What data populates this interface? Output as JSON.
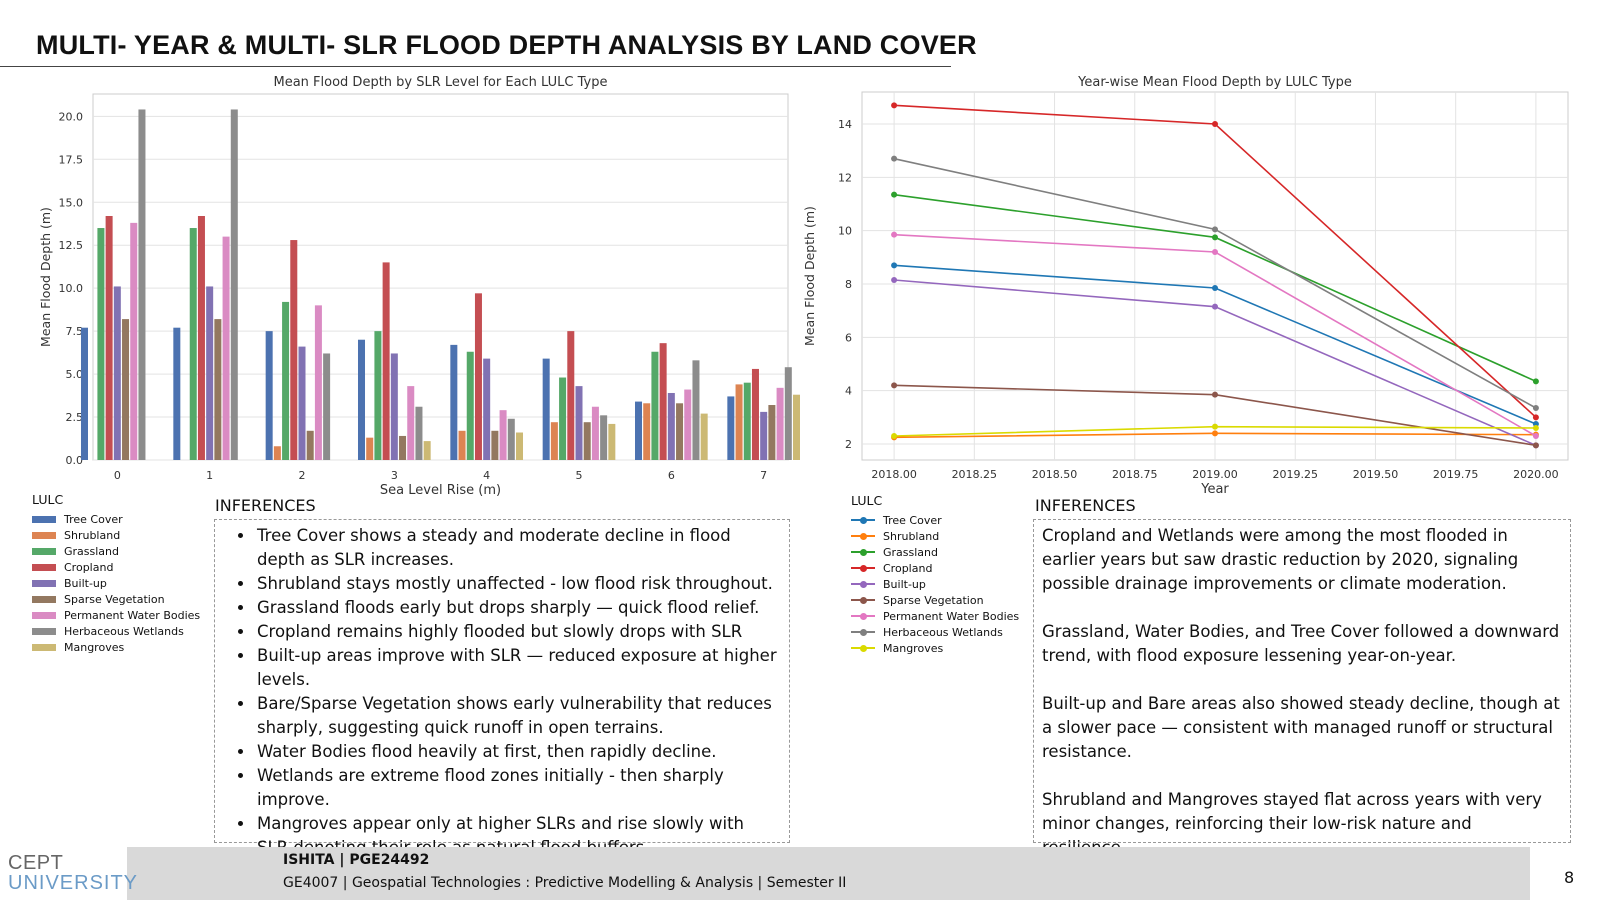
{
  "slide_title": "MULTI- YEAR & MULTI- SLR FLOOD DEPTH ANALYSIS BY LAND COVER",
  "colors": {
    "bar_palette": [
      "#4c72b0",
      "#dd8452",
      "#55a868",
      "#c44e52",
      "#8172b3",
      "#937860",
      "#da8bc3",
      "#8c8c8c",
      "#ccb974"
    ],
    "line_palette": [
      "#1f77b4",
      "#ff7f0e",
      "#2ca02c",
      "#d62728",
      "#9467bd",
      "#8c564b",
      "#e377c2",
      "#7f7f7f",
      "#dada00"
    ]
  },
  "chart_data": [
    {
      "type": "bar",
      "title": "Mean Flood Depth by SLR Level for Each LULC Type",
      "xlabel": "Sea Level Rise (m)",
      "ylabel": "Mean Flood Depth (m)",
      "categories": [
        "0",
        "1",
        "2",
        "3",
        "4",
        "5",
        "6",
        "7"
      ],
      "ylim": [
        0,
        21.3
      ],
      "yticks": [
        "0.0",
        "2.5",
        "5.0",
        "7.5",
        "10.0",
        "12.5",
        "15.0",
        "17.5",
        "20.0"
      ],
      "grid": true,
      "legend_title": "LULC",
      "legend_position": "below-left",
      "series": [
        {
          "name": "Tree Cover",
          "values": [
            7.7,
            7.7,
            7.5,
            7.0,
            6.7,
            5.9,
            3.4,
            3.7
          ]
        },
        {
          "name": "Shrubland",
          "values": [
            0,
            0,
            0.8,
            1.3,
            1.7,
            2.2,
            3.3,
            4.4
          ]
        },
        {
          "name": "Grassland",
          "values": [
            13.5,
            13.5,
            9.2,
            7.5,
            6.3,
            4.8,
            6.3,
            4.5
          ]
        },
        {
          "name": "Cropland",
          "values": [
            14.2,
            14.2,
            12.8,
            11.5,
            9.7,
            7.5,
            6.8,
            5.3
          ]
        },
        {
          "name": "Built-up",
          "values": [
            10.1,
            10.1,
            6.6,
            6.2,
            5.9,
            4.3,
            3.9,
            2.8
          ]
        },
        {
          "name": "Sparse Vegetation",
          "values": [
            8.2,
            8.2,
            1.7,
            1.4,
            1.7,
            2.2,
            3.3,
            3.2
          ]
        },
        {
          "name": "Permanent Water Bodies",
          "values": [
            13.8,
            13.0,
            9.0,
            4.3,
            2.9,
            3.1,
            4.1,
            4.2
          ]
        },
        {
          "name": "Herbaceous Wetlands",
          "values": [
            20.4,
            20.4,
            6.2,
            3.1,
            2.4,
            2.6,
            5.8,
            5.4
          ]
        },
        {
          "name": "Mangroves",
          "values": [
            0,
            0,
            0,
            1.1,
            1.6,
            2.1,
            2.7,
            3.8
          ]
        }
      ]
    },
    {
      "type": "line",
      "title": "Year-wise Mean Flood Depth by LULC Type",
      "xlabel": "Year",
      "ylabel": "Mean Flood Depth (m)",
      "x": [
        2018,
        2019,
        2020
      ],
      "xlim": [
        2017.9,
        2020.1
      ],
      "ylim": [
        1.4,
        15.2
      ],
      "xticks": [
        "2018.00",
        "2018.25",
        "2018.50",
        "2018.75",
        "2019.00",
        "2019.25",
        "2019.50",
        "2019.75",
        "2020.00"
      ],
      "yticks": [
        "2",
        "4",
        "6",
        "8",
        "10",
        "12",
        "14"
      ],
      "grid": true,
      "legend_title": "LULC",
      "legend_position": "below-left",
      "series": [
        {
          "name": "Tree Cover",
          "values": [
            8.7,
            7.85,
            2.75
          ]
        },
        {
          "name": "Shrubland",
          "values": [
            2.25,
            2.4,
            2.35
          ]
        },
        {
          "name": "Grassland",
          "values": [
            11.35,
            9.75,
            4.35
          ]
        },
        {
          "name": "Cropland",
          "values": [
            14.7,
            14.0,
            3.0
          ]
        },
        {
          "name": "Built-up",
          "values": [
            8.15,
            7.15,
            1.95
          ]
        },
        {
          "name": "Sparse Vegetation",
          "values": [
            4.2,
            3.85,
            1.95
          ]
        },
        {
          "name": "Permanent Water Bodies",
          "values": [
            9.85,
            9.2,
            2.3
          ]
        },
        {
          "name": "Herbaceous Wetlands",
          "values": [
            12.7,
            10.05,
            3.35
          ]
        },
        {
          "name": "Mangroves",
          "values": [
            2.3,
            2.65,
            2.6
          ]
        }
      ]
    }
  ],
  "inferences_left": {
    "heading": "INFERENCES",
    "items": [
      "Tree Cover shows a steady and moderate decline in flood depth as SLR increases.",
      "Shrubland stays mostly unaffected -  low flood risk throughout.",
      "Grassland floods early but drops sharply — quick flood relief.",
      "Cropland remains highly flooded but slowly drops with SLR",
      "Built-up areas improve with SLR — reduced exposure at higher levels.",
      "Bare/Sparse Vegetation shows early vulnerability that reduces sharply, suggesting quick runoff in open terrains.",
      "Water Bodies flood heavily at first, then rapidly decline.",
      "Wetlands are extreme flood zones initially - then sharply improve.",
      "Mangroves appear only at higher SLRs and rise slowly with SLR denoting their role as natural flood buffers."
    ]
  },
  "inferences_right": {
    "heading": "INFERENCES",
    "paragraphs": [
      "Cropland and Wetlands were among the most flooded in earlier years but saw drastic reduction by 2020, signaling possible drainage improvements or climate moderation.",
      "Grassland, Water Bodies, and Tree Cover followed a downward trend, with flood exposure lessening year-on-year.",
      "Built-up and Bare areas also showed steady decline, though at a slower pace — consistent with managed runoff or structural resistance.",
      "Shrubland and Mangroves stayed flat across years with very minor changes, reinforcing their low-risk nature and resilience."
    ]
  },
  "footer": {
    "logo_line1": "CEPT",
    "logo_line2": "UNIVERSITY",
    "name": "ISHITA | PGE24492",
    "course": "GE4007 | Geospatial Technologies : Predictive Modelling & Analysis | Semester II",
    "page_number": "8"
  }
}
